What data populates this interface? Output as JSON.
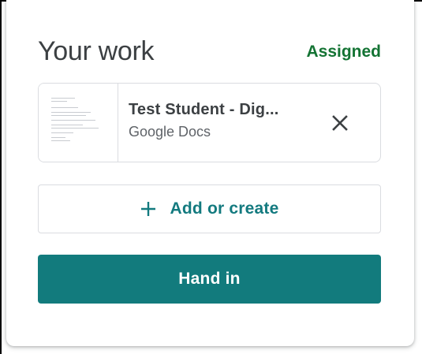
{
  "your_work": {
    "title": "Your work",
    "status": "Assigned",
    "status_color": "#137333"
  },
  "attachment": {
    "name": "Test Student - Dig...",
    "type": "Google Docs",
    "thumbnail_icon": "document-thumbnail",
    "remove_icon": "close-icon"
  },
  "add_button": {
    "icon": "plus-icon",
    "label": "Add or create"
  },
  "handin_button": {
    "label": "Hand in",
    "color": "#127b7d"
  }
}
